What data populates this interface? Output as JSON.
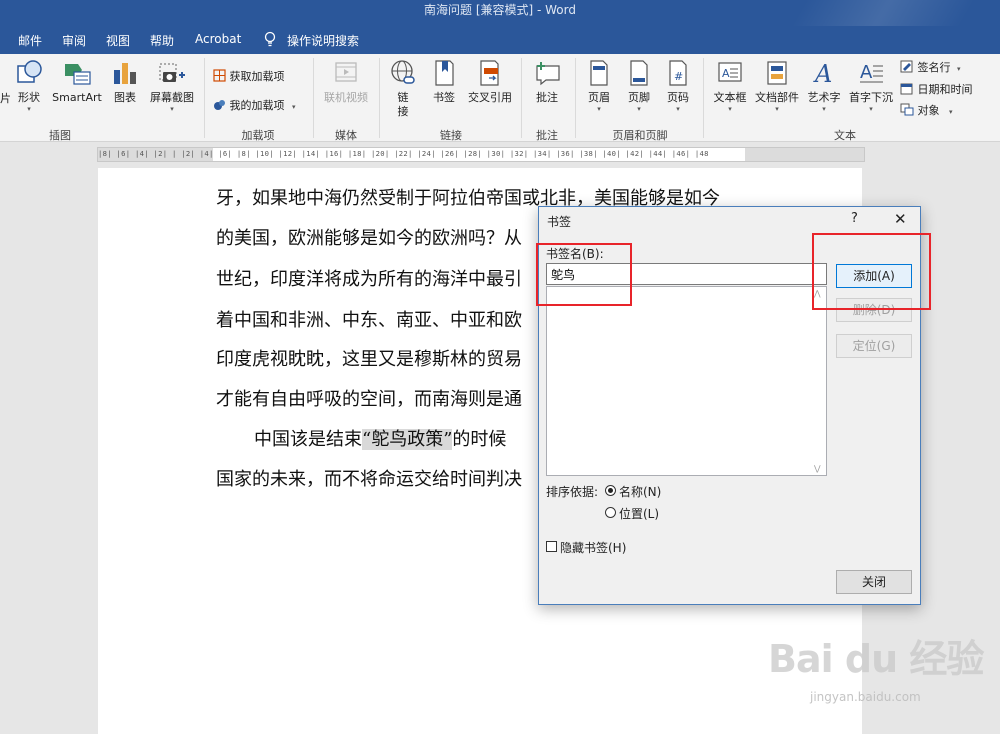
{
  "window": {
    "title": "南海问题 [兼容模式] - Word"
  },
  "menu_tabs": [
    "邮件",
    "审阅",
    "视图",
    "帮助",
    "Acrobat"
  ],
  "tell_me": "操作说明搜索",
  "ribbon": {
    "illustrations": {
      "partial_label": "片",
      "shapes": "形状",
      "smartart": "SmartArt",
      "chart": "图表",
      "screenshot": "屏幕截图",
      "group": "插图"
    },
    "addins": {
      "get": "获取加载项",
      "mine": "我的加载项",
      "group": "加载项"
    },
    "media": {
      "online_video": "联机视频",
      "group": "媒体"
    },
    "links": {
      "link": "链接",
      "bookmark": "书签",
      "cross_ref": "交叉引用",
      "group": "链接"
    },
    "comments": {
      "comment": "批注",
      "group": "批注"
    },
    "header_footer": {
      "header": "页眉",
      "footer": "页脚",
      "page_number": "页码",
      "group": "页眉和页脚"
    },
    "text": {
      "textbox": "文本框",
      "quick_parts": "文档部件",
      "wordart": "艺术字",
      "dropcap": "首字下沉",
      "signature": "签名行",
      "datetime": "日期和时间",
      "object": "对象",
      "group": "文本"
    }
  },
  "ruler": {
    "text": "|8|  |6|  |4|  |2|      |   |2|  |4|  |6|  |8|  |10|  |12|  |14|  |16|  |18|  |20|  |22|  |24|  |26|  |28|  |30|  |32|  |34|  |36|  |38|  |40|  |42|  |44|  |46|  |48"
  },
  "document": {
    "lines": [
      "牙，如果地中海仍然受制于阿拉伯帝国或北非，美国能够是如今",
      "的美国，欧洲能够是如今的欧洲吗？从",
      "世纪，印度洋将成为所有的海洋中最引",
      "着中国和非洲、中东、南亚、中亚和欧",
      "印度虎视眈眈，这里又是穆斯林的贸易",
      "才能有自由呼吸的空间，而南海则是通"
    ],
    "para2_before": "中国该是结束",
    "para2_highlight": "“鸵鸟政策”",
    "para2_after": "的时候",
    "last_line": "国家的未来，而不将命运交给时间判决"
  },
  "dialog": {
    "title": "书签",
    "help": "?",
    "close": "✕",
    "name_label": "书签名(B):",
    "name_value": "鸵鸟",
    "add": "添加(A)",
    "delete": "删除(D)",
    "goto": "定位(G)",
    "sort_label": "排序依据:",
    "sort_name": "名称(N)",
    "sort_location": "位置(L)",
    "hidden": "隐藏书签(H)",
    "close_button": "关闭"
  },
  "watermark": {
    "brand": "Bai du 经验",
    "url": "jingyan.baidu.com"
  },
  "colors": {
    "title_bar": "#2b579a",
    "annotation": "#e8242a",
    "highlight": "#d9d9d9"
  }
}
